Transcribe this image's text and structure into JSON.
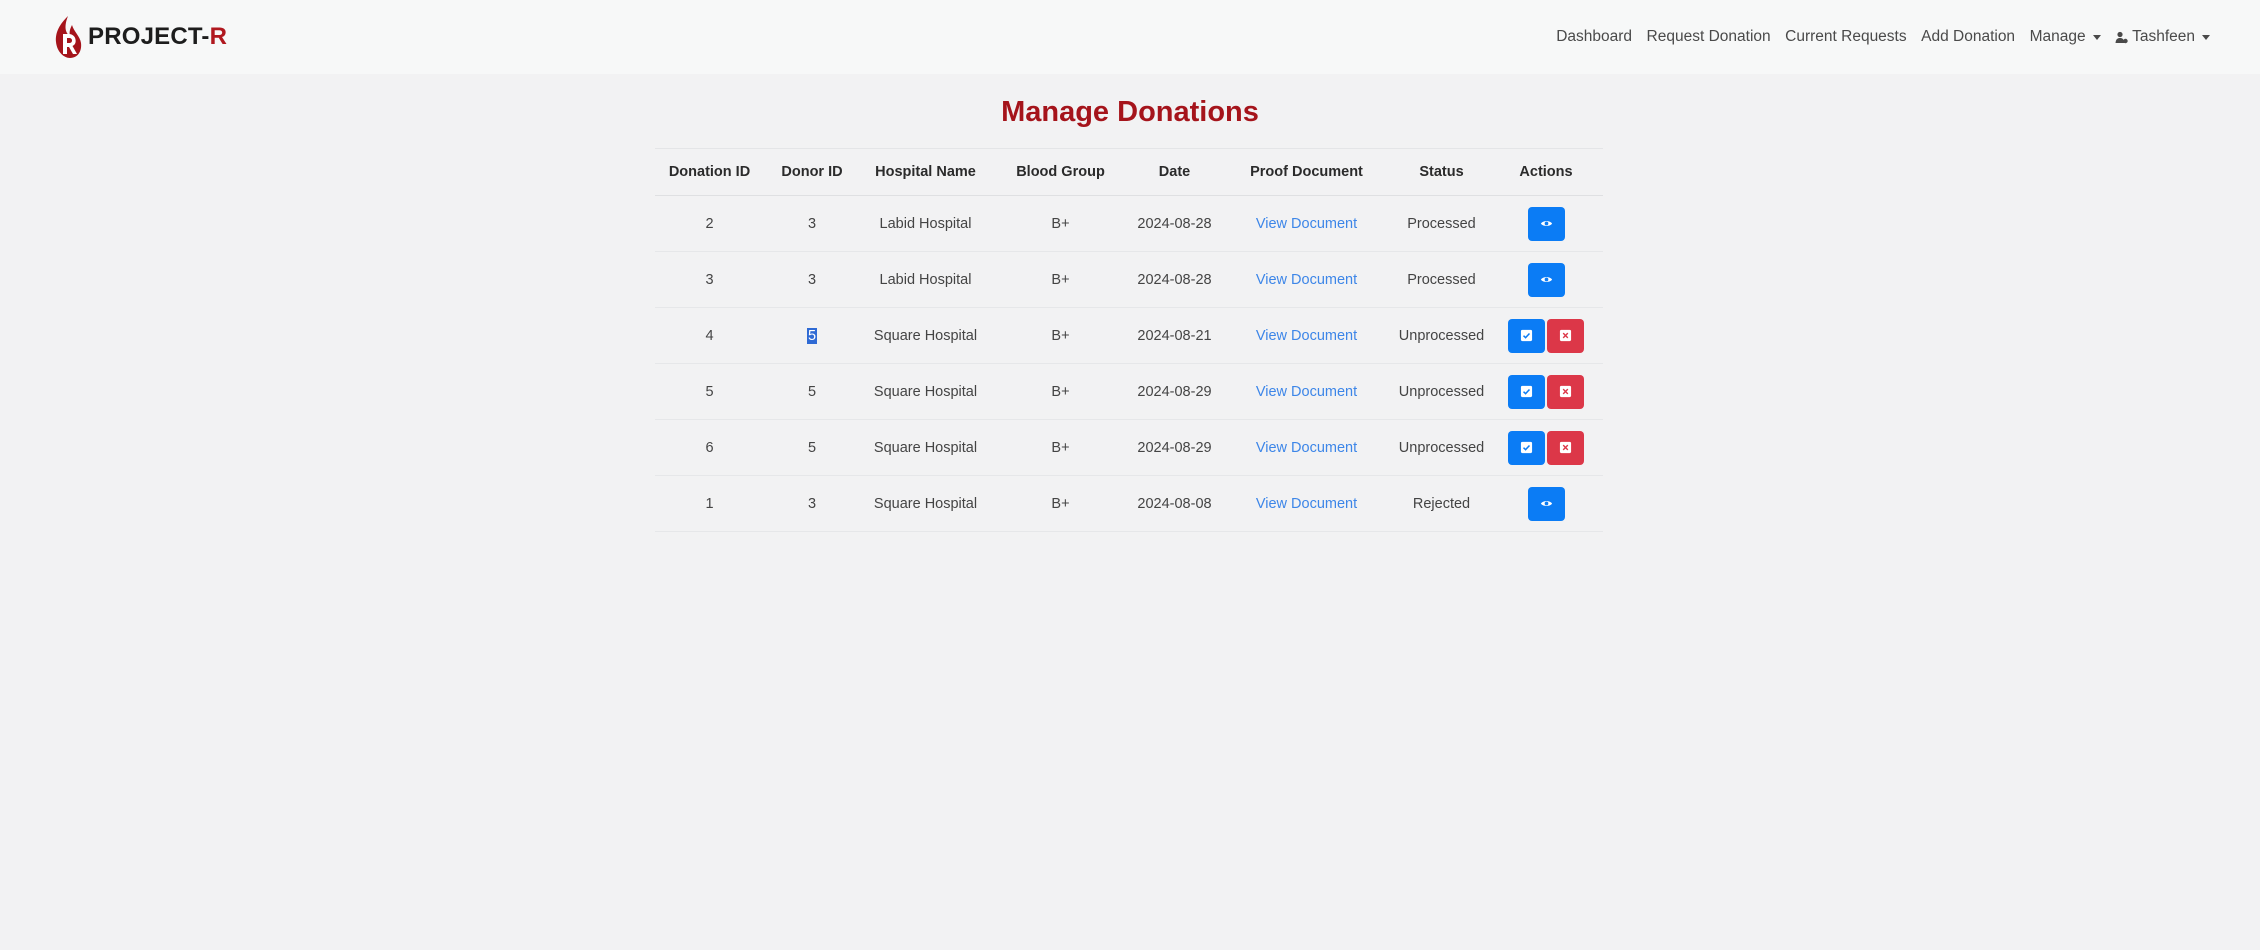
{
  "brand": {
    "name_main": "PROJECT-",
    "name_suffix": "R"
  },
  "nav": {
    "dashboard": "Dashboard",
    "request_donation": "Request Donation",
    "current_requests": "Current Requests",
    "add_donation": "Add Donation",
    "manage": "Manage",
    "user": "Tashfeen"
  },
  "page": {
    "title": "Manage Donations"
  },
  "table": {
    "headers": [
      "Donation ID",
      "Donor ID",
      "Hospital Name",
      "Blood Group",
      "Date",
      "Proof Document",
      "Status",
      "Actions"
    ],
    "rows": [
      {
        "donation_id": "2",
        "donor_id": "3",
        "hospital": "Labid Hospital",
        "blood_group": "B+",
        "date": "2024-08-28",
        "proof": "View Document",
        "status": "Processed",
        "actions": [
          "view"
        ]
      },
      {
        "donation_id": "3",
        "donor_id": "3",
        "hospital": "Labid Hospital",
        "blood_group": "B+",
        "date": "2024-08-28",
        "proof": "View Document",
        "status": "Processed",
        "actions": [
          "view"
        ]
      },
      {
        "donation_id": "4",
        "donor_id": "5",
        "hospital": "Square Hospital",
        "blood_group": "B+",
        "date": "2024-08-21",
        "proof": "View Document",
        "status": "Unprocessed",
        "actions": [
          "approve",
          "reject"
        ],
        "donor_selected": true
      },
      {
        "donation_id": "5",
        "donor_id": "5",
        "hospital": "Square Hospital",
        "blood_group": "B+",
        "date": "2024-08-29",
        "proof": "View Document",
        "status": "Unprocessed",
        "actions": [
          "approve",
          "reject"
        ]
      },
      {
        "donation_id": "6",
        "donor_id": "5",
        "hospital": "Square Hospital",
        "blood_group": "B+",
        "date": "2024-08-29",
        "proof": "View Document",
        "status": "Unprocessed",
        "actions": [
          "approve",
          "reject"
        ]
      },
      {
        "donation_id": "1",
        "donor_id": "3",
        "hospital": "Square Hospital",
        "blood_group": "B+",
        "date": "2024-08-08",
        "proof": "View Document",
        "status": "Rejected",
        "actions": [
          "view"
        ]
      }
    ]
  },
  "icons": {
    "view": "eye-icon",
    "approve": "check-square-icon",
    "reject": "x-square-icon",
    "user": "user-icon",
    "dropdown": "chevron-down-icon"
  },
  "colors": {
    "brand": "#a5141b",
    "primary_button": "#0b7cf5",
    "danger_button": "#dc3748",
    "link": "#3d86e8"
  }
}
